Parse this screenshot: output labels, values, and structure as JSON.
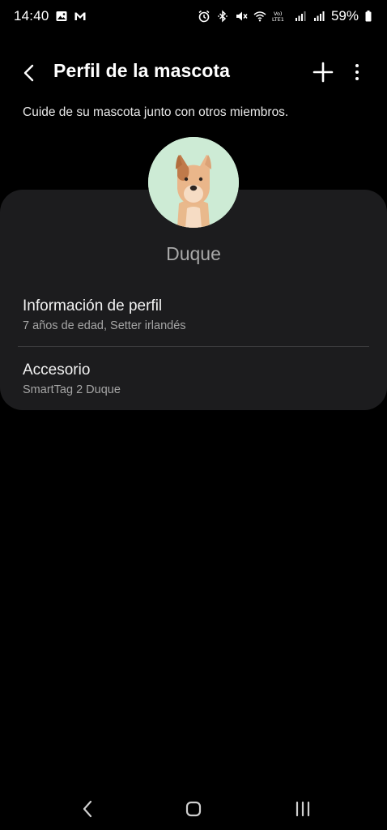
{
  "status_bar": {
    "time": "14:40",
    "battery": "59%",
    "icons_left": [
      "gallery-icon",
      "gmail-icon"
    ],
    "icons_right": [
      "alarm-icon",
      "bluetooth-icon",
      "mute-icon",
      "wifi-icon",
      "volte-icon",
      "signal-icon",
      "signal-icon",
      "battery-icon"
    ]
  },
  "header": {
    "title": "Perfil de la mascota",
    "back_icon": "chevron-left-icon",
    "add_icon": "plus-icon",
    "more_icon": "more-vertical-icon"
  },
  "subtitle": "Cuide de su mascota junto con otros miembros.",
  "pet": {
    "name": "Duque",
    "avatar_bg": "#cdebd5"
  },
  "items": [
    {
      "title": "Información de perfil",
      "subtitle": "7 años de edad, Setter irlandés"
    },
    {
      "title": "Accesorio",
      "subtitle": "SmartTag 2 Duque"
    }
  ],
  "nav": {
    "back_icon": "nav-back-icon",
    "home_icon": "nav-home-icon",
    "recents_icon": "nav-recents-icon"
  },
  "colors": {
    "background": "#000000",
    "card": "#1c1c1e",
    "divider": "#3a3a3c"
  }
}
